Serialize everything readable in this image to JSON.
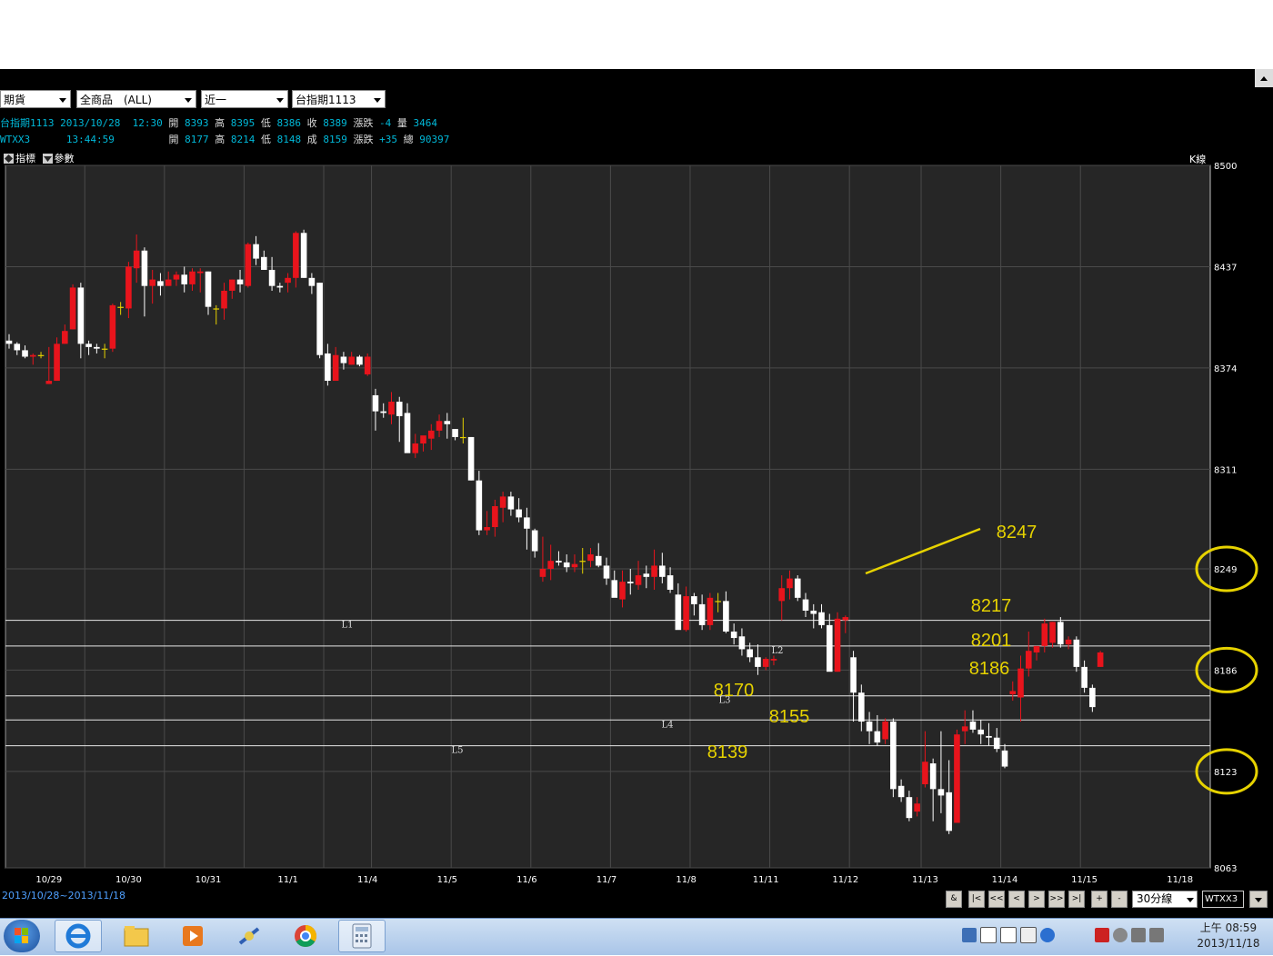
{
  "selectors": {
    "type": "期貨",
    "product": "全商品　(ALL)",
    "contract": "近一",
    "symbol": "台指期1113"
  },
  "quote1": {
    "name": "台指期1113",
    "datetime": "2013/10/28  12:30",
    "open_label": "開",
    "open": "8393",
    "high_label": "高",
    "high": "8395",
    "low_label": "低",
    "low": "8386",
    "close_label": "收",
    "close": "8389",
    "chg_label": "漲跌",
    "chg": "-4",
    "vol_label": "量",
    "vol": "3464"
  },
  "quote2": {
    "name": "WTXX3",
    "time": "13:44:59",
    "open_label": "開",
    "open": "8177",
    "high_label": "高",
    "high": "8214",
    "low_label": "低",
    "low": "8148",
    "last_label": "成",
    "last": "8159",
    "chg_label": "漲跌",
    "chg": "+35",
    "total_label": "總",
    "total": "90397"
  },
  "toolbar": {
    "indicator": "指標",
    "params": "參數",
    "kline": "K線"
  },
  "range_text": "2013/10/28~2013/11/18",
  "nav": {
    "amp": "&",
    "first": "|<",
    "fastback": "<<",
    "back": "<",
    "fwd": ">",
    "fastfwd": ">>",
    "last": ">|",
    "plus": "+",
    "minus": "-",
    "interval": "30分線",
    "code": "WTXX3"
  },
  "clock": {
    "time": "上午 08:59",
    "date": "2013/11/18"
  },
  "colors": {
    "up": "#e8141c",
    "down": "#ffffff",
    "flat": "#e6d200",
    "annotation": "#e6d200",
    "grid": "#4a4a4a",
    "background": "#262626"
  },
  "chart_data": {
    "type": "candlestick",
    "ylim": [
      8063,
      8500
    ],
    "y_ticks": [
      "8500",
      "8437",
      "8374",
      "8311",
      "8249",
      "8186",
      "8123",
      "8063"
    ],
    "x_ticks": [
      "10/29",
      "10/30",
      "10/31",
      "11/1",
      "11/4",
      "11/5",
      "11/6",
      "11/7",
      "11/8",
      "11/11",
      "11/12",
      "11/13",
      "11/14",
      "11/15",
      "11/18"
    ],
    "circled_ticks": [
      "8249",
      "8186",
      "8123"
    ],
    "hlines": [
      {
        "name": "L1",
        "value": 8217
      },
      {
        "name": "L2",
        "value": 8201
      },
      {
        "name": "L3",
        "value": 8170
      },
      {
        "name": "L4",
        "value": 8155
      },
      {
        "name": "L5",
        "value": 8139
      }
    ],
    "annotations": [
      "8247",
      "8217",
      "8201",
      "8186",
      "8170",
      "8155",
      "8139"
    ],
    "trend_note": "8247",
    "candles": [
      [
        8391,
        8395,
        8386,
        8389
      ],
      [
        8389,
        8390,
        8382,
        8385
      ],
      [
        8385,
        8388,
        8380,
        8381
      ],
      [
        8381,
        8383,
        8376,
        8382
      ],
      [
        8382,
        8384,
        8380,
        8382
      ],
      [
        8364,
        8387,
        8364,
        8366
      ],
      [
        8366,
        8393,
        8366,
        8389
      ],
      [
        8389,
        8401,
        8389,
        8397
      ],
      [
        8398,
        8426,
        8398,
        8424
      ],
      [
        8424,
        8427,
        8380,
        8389
      ],
      [
        8389,
        8391,
        8382,
        8387
      ],
      [
        8387,
        8389,
        8383,
        8386
      ],
      [
        8386,
        8389,
        8380,
        8386
      ],
      [
        8386,
        8414,
        8384,
        8413
      ],
      [
        8412,
        8415,
        8407,
        8412
      ],
      [
        8411,
        8440,
        8405,
        8437
      ],
      [
        8436,
        8457,
        8427,
        8447
      ],
      [
        8447,
        8449,
        8406,
        8425
      ],
      [
        8425,
        8435,
        8414,
        8429
      ],
      [
        8428,
        8433,
        8419,
        8425
      ],
      [
        8425,
        8434,
        8425,
        8429
      ],
      [
        8429,
        8434,
        8425,
        8432
      ],
      [
        8432,
        8437,
        8421,
        8426
      ],
      [
        8426,
        8436,
        8422,
        8434
      ],
      [
        8433,
        8436,
        8421,
        8434
      ],
      [
        8434,
        8434,
        8407,
        8412
      ],
      [
        8411,
        8413,
        8401,
        8411
      ],
      [
        8411,
        8427,
        8404,
        8422
      ],
      [
        8422,
        8429,
        8417,
        8429
      ],
      [
        8429,
        8435,
        8421,
        8426
      ],
      [
        8425,
        8452,
        8424,
        8451
      ],
      [
        8451,
        8456,
        8438,
        8442
      ],
      [
        8443,
        8447,
        8435,
        8435
      ],
      [
        8435,
        8443,
        8422,
        8425
      ],
      [
        8425,
        8427,
        8421,
        8424
      ],
      [
        8427,
        8433,
        8421,
        8430
      ],
      [
        8430,
        8459,
        8424,
        8458
      ],
      [
        8458,
        8460,
        8430,
        8430
      ],
      [
        8430,
        8433,
        8420,
        8425
      ],
      [
        8427,
        8427,
        8380,
        8382
      ],
      [
        8383,
        8389,
        8363,
        8366
      ],
      [
        8366,
        8387,
        8366,
        8382
      ],
      [
        8381,
        8384,
        8373,
        8377
      ],
      [
        8376,
        8384,
        8376,
        8381
      ],
      [
        8381,
        8382,
        8375,
        8376
      ],
      [
        8370,
        8383,
        8369,
        8381
      ],
      [
        8357,
        8361,
        8335,
        8347
      ],
      [
        8347,
        8352,
        8343,
        8346
      ],
      [
        8345,
        8359,
        8339,
        8353
      ],
      [
        8353,
        8356,
        8328,
        8344
      ],
      [
        8346,
        8352,
        8329,
        8321
      ],
      [
        8321,
        8333,
        8318,
        8327
      ],
      [
        8327,
        8331,
        8322,
        8332
      ],
      [
        8330,
        8339,
        8323,
        8335
      ],
      [
        8335,
        8345,
        8331,
        8341
      ],
      [
        8341,
        8346,
        8330,
        8339
      ],
      [
        8336,
        8336,
        8329,
        8331
      ],
      [
        8331,
        8343,
        8327,
        8331
      ],
      [
        8331,
        8331,
        8304,
        8304
      ],
      [
        8304,
        8310,
        8270,
        8273
      ],
      [
        8273,
        8285,
        8270,
        8275
      ],
      [
        8275,
        8292,
        8269,
        8288
      ],
      [
        8287,
        8297,
        8278,
        8294
      ],
      [
        8294,
        8297,
        8282,
        8286
      ],
      [
        8286,
        8293,
        8278,
        8281
      ],
      [
        8281,
        8287,
        8261,
        8274
      ],
      [
        8273,
        8274,
        8256,
        8260
      ],
      [
        8244,
        8269,
        8241,
        8249
      ],
      [
        8249,
        8264,
        8242,
        8254
      ],
      [
        8254,
        8260,
        8251,
        8253
      ],
      [
        8253,
        8258,
        8247,
        8250
      ],
      [
        8250,
        8258,
        8247,
        8252
      ],
      [
        8254,
        8262,
        8246,
        8254
      ],
      [
        8254,
        8262,
        8250,
        8258
      ],
      [
        8257,
        8265,
        8250,
        8251
      ],
      [
        8251,
        8256,
        8239,
        8243
      ],
      [
        8242,
        8248,
        8233,
        8231
      ],
      [
        8230,
        8248,
        8225,
        8241
      ],
      [
        8241,
        8249,
        8233,
        8240
      ],
      [
        8239,
        8254,
        8236,
        8245
      ],
      [
        8246,
        8251,
        8237,
        8244
      ],
      [
        8244,
        8261,
        8236,
        8251
      ],
      [
        8251,
        8259,
        8240,
        8244
      ],
      [
        8245,
        8250,
        8234,
        8236
      ],
      [
        8233,
        8240,
        8217,
        8211
      ],
      [
        8211,
        8238,
        8210,
        8232
      ],
      [
        8232,
        8234,
        8220,
        8227
      ],
      [
        8227,
        8233,
        8211,
        8214
      ],
      [
        8214,
        8234,
        8211,
        8231
      ],
      [
        8229,
        8234,
        8222,
        8229
      ],
      [
        8229,
        8235,
        8209,
        8210
      ],
      [
        8210,
        8215,
        8202,
        8206
      ],
      [
        8207,
        8212,
        8195,
        8199
      ],
      [
        8199,
        8203,
        8191,
        8194
      ],
      [
        8194,
        8202,
        8183,
        8188
      ],
      [
        8188,
        8194,
        8186,
        8193
      ],
      [
        8192,
        8195,
        8189,
        8193
      ],
      [
        8229,
        8245,
        8217,
        8237
      ],
      [
        8237,
        8248,
        8230,
        8243
      ],
      [
        8243,
        8245,
        8229,
        8231
      ],
      [
        8230,
        8234,
        8219,
        8223
      ],
      [
        8223,
        8227,
        8212,
        8221
      ],
      [
        8222,
        8227,
        8212,
        8214
      ],
      [
        8214,
        8221,
        8198,
        8185
      ],
      [
        8185,
        8222,
        8185,
        8218
      ],
      [
        8217,
        8220,
        8209,
        8219
      ],
      [
        8194,
        8198,
        8154,
        8172
      ],
      [
        8172,
        8177,
        8148,
        8154
      ],
      [
        8154,
        8160,
        8140,
        8148
      ],
      [
        8148,
        8158,
        8139,
        8141
      ],
      [
        8143,
        8156,
        8140,
        8154
      ],
      [
        8154,
        8156,
        8107,
        8112
      ],
      [
        8114,
        8118,
        8104,
        8107
      ],
      [
        8107,
        8111,
        8092,
        8094
      ],
      [
        8098,
        8107,
        8095,
        8103
      ],
      [
        8115,
        8148,
        8113,
        8129
      ],
      [
        8128,
        8131,
        8092,
        8112
      ],
      [
        8112,
        8148,
        8097,
        8108
      ],
      [
        8110,
        8130,
        8084,
        8086
      ],
      [
        8091,
        8149,
        8091,
        8146
      ],
      [
        8148,
        8161,
        8140,
        8151
      ],
      [
        8154,
        8161,
        8147,
        8149
      ],
      [
        8149,
        8155,
        8140,
        8146
      ],
      [
        8145,
        8153,
        8139,
        8144
      ],
      [
        8144,
        8150,
        8135,
        8137
      ],
      [
        8136,
        8140,
        8125,
        8126
      ],
      [
        8171,
        8179,
        8167,
        8173
      ],
      [
        8169,
        8195,
        8154,
        8187
      ],
      [
        8187,
        8210,
        8182,
        8198
      ],
      [
        8197,
        8201,
        8192,
        8201
      ],
      [
        8201,
        8218,
        8197,
        8215
      ],
      [
        8203,
        8216,
        8200,
        8216
      ],
      [
        8216,
        8219,
        8200,
        8202
      ],
      [
        8202,
        8207,
        8199,
        8205
      ],
      [
        8205,
        8207,
        8185,
        8188
      ],
      [
        8188,
        8192,
        8172,
        8175
      ],
      [
        8175,
        8177,
        8160,
        8163
      ],
      [
        8188,
        8198,
        8188,
        8197
      ]
    ],
    "day_starts": [
      0,
      10,
      20,
      30,
      40,
      46,
      56,
      66,
      76,
      86,
      96,
      106,
      115,
      125,
      135
    ],
    "day_label_indices": [
      5,
      15,
      25,
      35,
      45,
      55,
      65,
      75,
      85,
      95,
      105,
      115,
      125,
      135,
      147
    ]
  }
}
